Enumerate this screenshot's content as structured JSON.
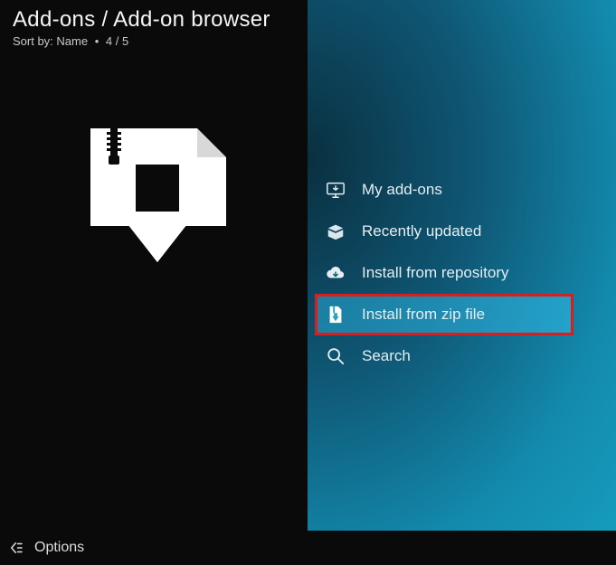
{
  "header": {
    "title": "Add-ons / Add-on browser",
    "sort_label": "Sort by:",
    "sort_value": "Name",
    "position": "4 / 5"
  },
  "menu": {
    "items": [
      {
        "label": "My add-ons"
      },
      {
        "label": "Recently updated"
      },
      {
        "label": "Install from repository"
      },
      {
        "label": "Install from zip file"
      },
      {
        "label": "Search"
      }
    ],
    "selected_index": 3
  },
  "footer": {
    "options_label": "Options"
  }
}
